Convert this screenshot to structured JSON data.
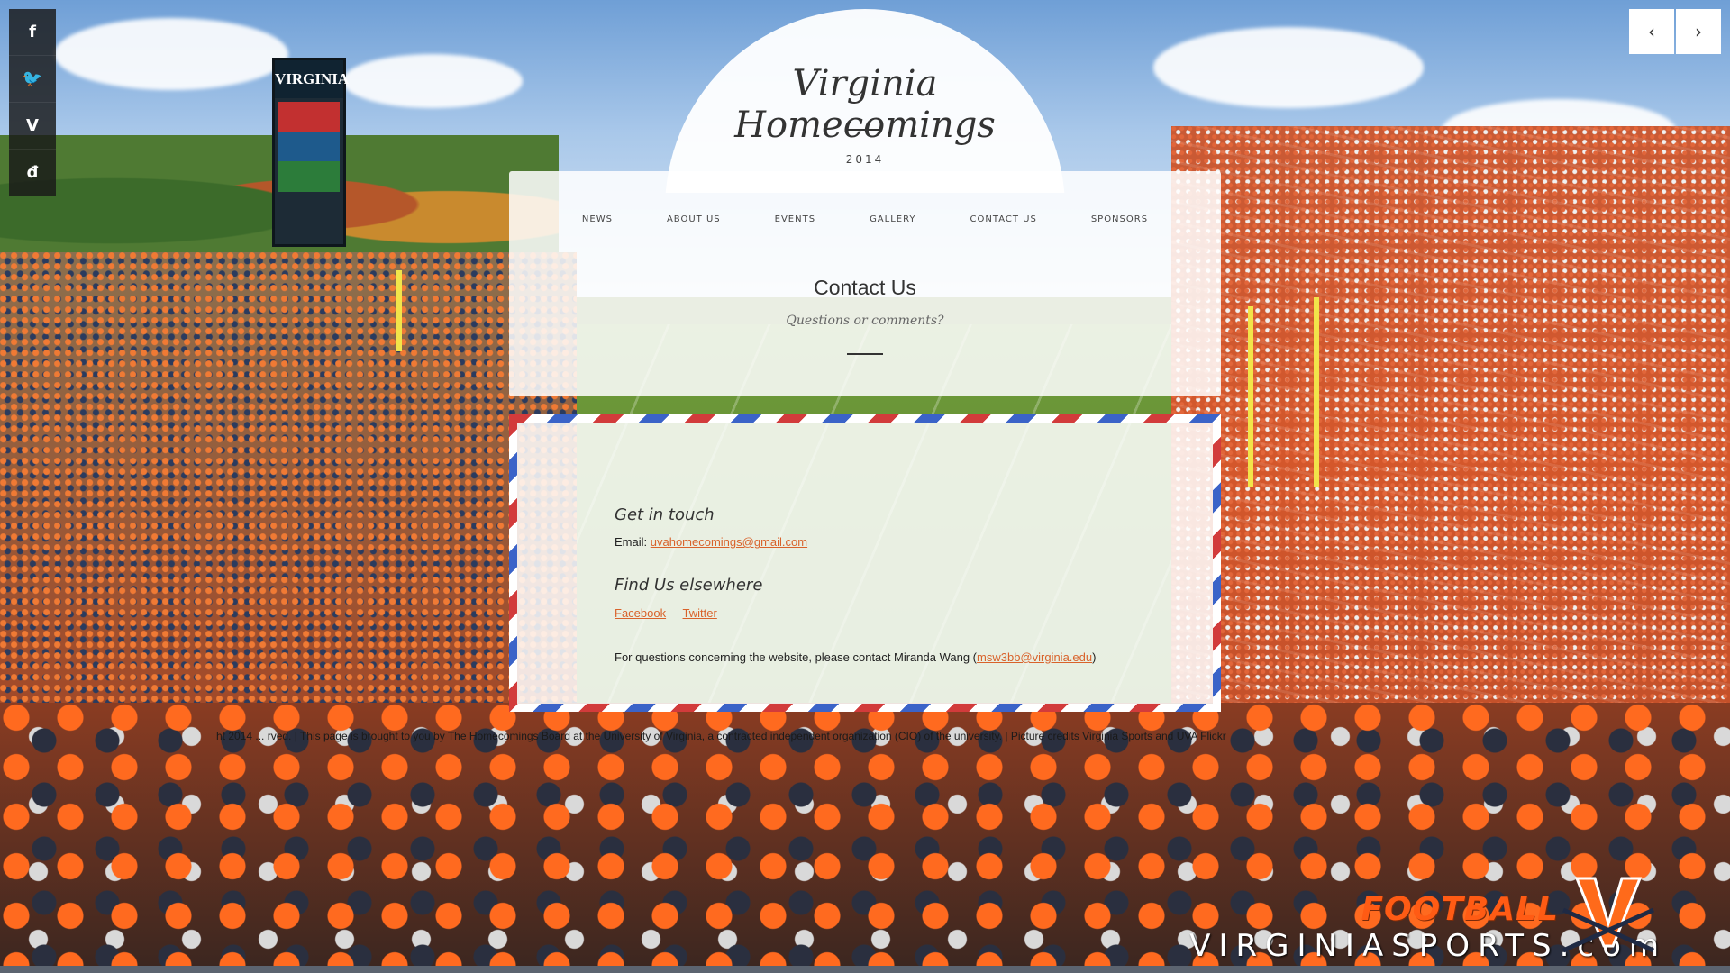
{
  "site": {
    "title": "Virginia Homecomings",
    "year": "2014"
  },
  "social": [
    {
      "icon": "facebook-icon",
      "glyph": "f"
    },
    {
      "icon": "twitter-icon",
      "glyph": "🐦"
    },
    {
      "icon": "vimeo-icon",
      "glyph": "V"
    },
    {
      "icon": "tumblr-icon",
      "glyph": "đ"
    }
  ],
  "arrows": {
    "prev": "‹",
    "next": "›"
  },
  "menu": [
    "NEWS",
    "ABOUT US",
    "EVENTS",
    "GALLERY",
    "CONTACT US",
    "SPONSORS"
  ],
  "page": {
    "title": "Contact Us",
    "subtitle": "Questions or comments?"
  },
  "contact": {
    "get_in_touch": "Get in touch",
    "email_label": "Email:",
    "email": "uvahomecomings@gmail.com",
    "find_us": "Find Us elsewhere",
    "facebook": "Facebook",
    "twitter": "Twitter",
    "website_note_prefix": "For questions concerning the website, please contact Miranda Wang (",
    "website_email": "msw3bb@virginia.edu",
    "website_note_suffix": ")"
  },
  "footer": "ht 2014 ... rved. | This page is brought to you by The Homecomings Board at the University of Virginia, a contracted independent organization (CIO) of the university. | Picture credits Virginia Sports and UVA Flickr",
  "background": {
    "scoreboard_text": "VIRGINIA",
    "brand_football": "FOOTBALL",
    "brand_site": "VIRGINIASPORTS.com"
  },
  "colors": {
    "accent": "#d9622b",
    "airmail_red": "#d23b3b",
    "airmail_blue": "#3b63c8"
  }
}
